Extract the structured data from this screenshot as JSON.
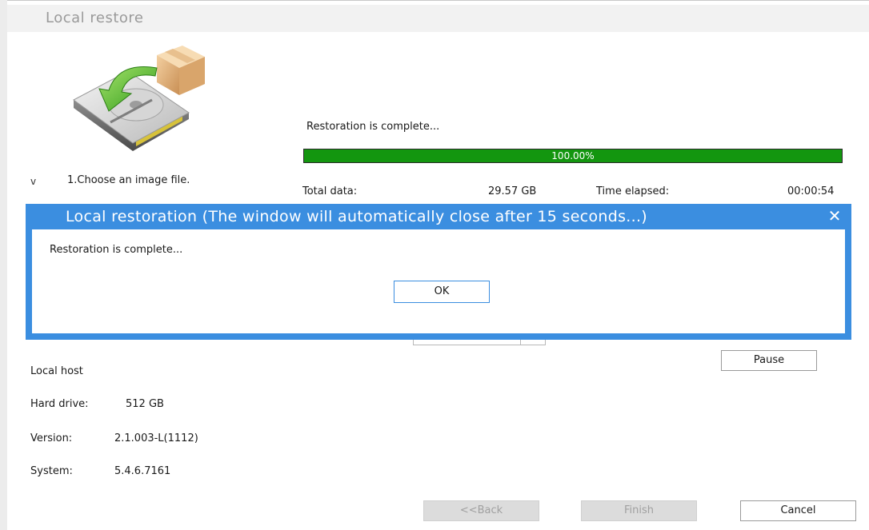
{
  "window": {
    "title": "Local restore"
  },
  "step": {
    "marker": "v",
    "label": "1.Choose an image file."
  },
  "status": {
    "text": "Restoration is complete..."
  },
  "progress": {
    "percent_label": "100.00%",
    "fraction": 1.0
  },
  "stats": {
    "total_label": "Total data:",
    "total_value": "29.57 GB",
    "time_label": "Time elapsed:",
    "time_value": "00:00:54"
  },
  "buttons": {
    "pause": "Pause",
    "back": "<<Back",
    "finish": "Finish",
    "cancel": "Cancel"
  },
  "info": {
    "host": "Local host",
    "hard_drive_label": "Hard drive:",
    "hard_drive_value": "512 GB",
    "version_label": "Version:",
    "version_value": "2.1.003-L(1112)",
    "system_label": "System:",
    "system_value": "5.4.6.7161"
  },
  "dialog": {
    "title": "Local restoration (The window will automatically close after 15 seconds...)",
    "close_glyph": "✕",
    "message": "Restoration is complete...",
    "ok": "OK"
  },
  "colors": {
    "progress_fill": "#13960f",
    "dialog_frame": "#3b8ee0"
  },
  "icons": {
    "restore": "hard-drive-restore-icon"
  }
}
